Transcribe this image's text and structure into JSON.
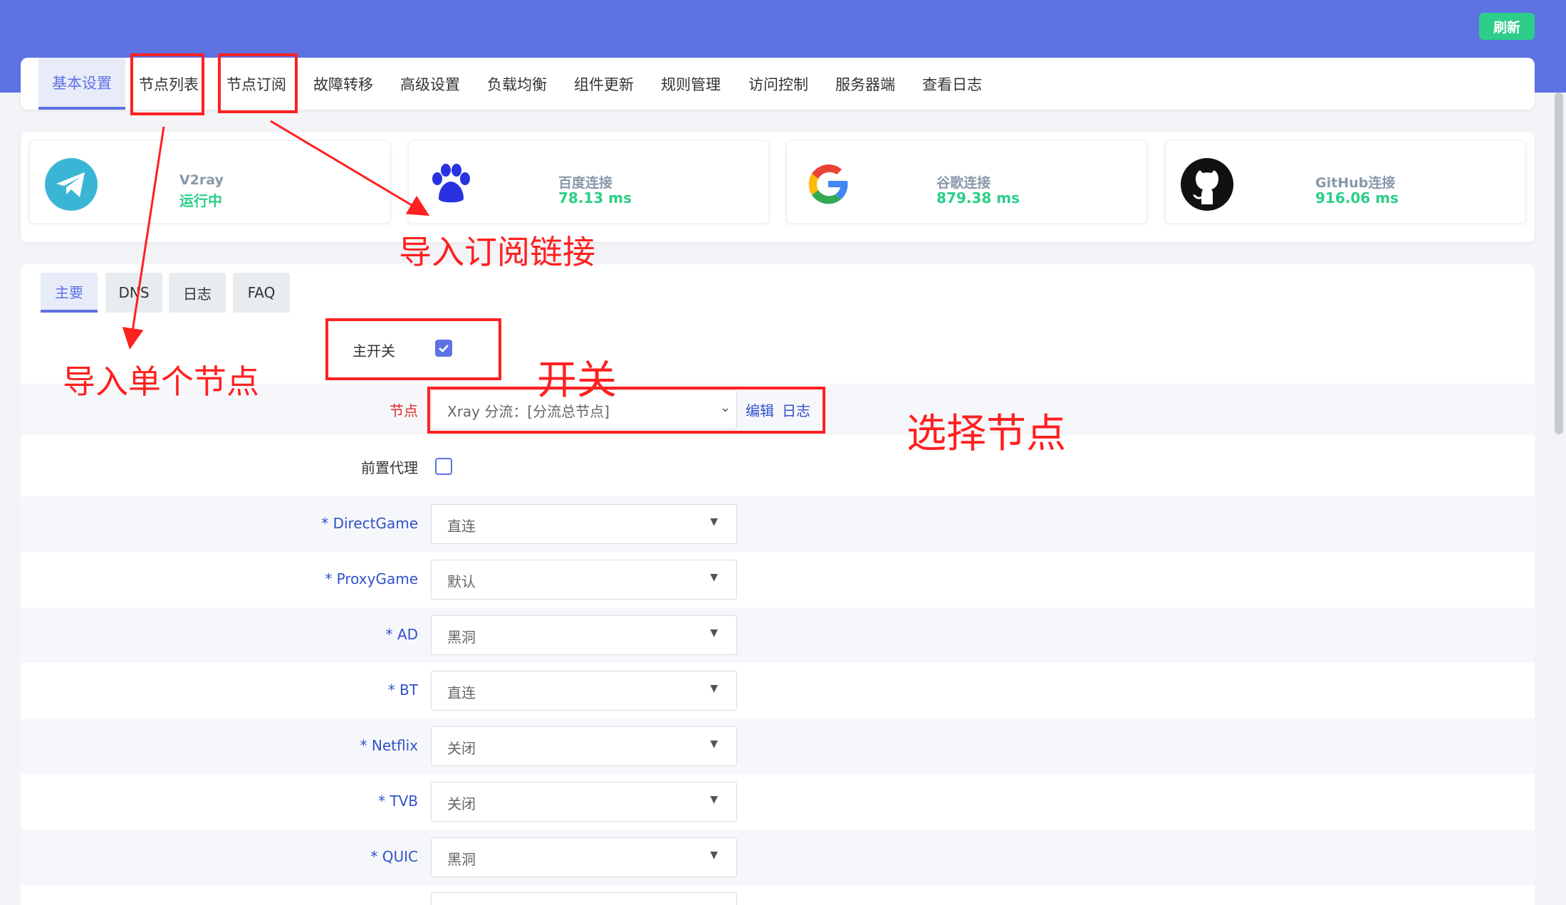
{
  "header": {
    "refresh_label": "刷新"
  },
  "nav": {
    "tabs": [
      {
        "label": "基本设置",
        "active": true
      },
      {
        "label": "节点列表"
      },
      {
        "label": "节点订阅"
      },
      {
        "label": "故障转移"
      },
      {
        "label": "高级设置"
      },
      {
        "label": "负载均衡"
      },
      {
        "label": "组件更新"
      },
      {
        "label": "规则管理"
      },
      {
        "label": "访问控制"
      },
      {
        "label": "服务器端"
      },
      {
        "label": "查看日志"
      }
    ]
  },
  "status": [
    {
      "name": "V2ray",
      "value": "运行中",
      "icon": "telegram-plane-icon"
    },
    {
      "name": "百度连接",
      "value": "78.13 ms",
      "icon": "baidu-paw-icon"
    },
    {
      "name": "谷歌连接",
      "value": "879.38 ms",
      "icon": "google-g-icon"
    },
    {
      "name": "GitHub连接",
      "value": "916.06 ms",
      "icon": "github-icon"
    }
  ],
  "subtabs": [
    {
      "label": "主要",
      "active": true
    },
    {
      "label": "DNS"
    },
    {
      "label": "日志"
    },
    {
      "label": "FAQ"
    }
  ],
  "form": {
    "main_switch": {
      "label": "主开关",
      "checked": true
    },
    "node": {
      "label": "节点",
      "value": "Xray 分流：[分流总节点]",
      "edit": "编辑",
      "log": "日志"
    },
    "pre_proxy": {
      "label": "前置代理",
      "checked": false
    },
    "shunt_rules": [
      {
        "label": "* DirectGame",
        "value": "直连"
      },
      {
        "label": "* ProxyGame",
        "value": "默认"
      },
      {
        "label": "* AD",
        "value": "黑洞"
      },
      {
        "label": "* BT",
        "value": "直连"
      },
      {
        "label": "* Netflix",
        "value": "关闭"
      },
      {
        "label": "* TVB",
        "value": "关闭"
      },
      {
        "label": "* QUIC",
        "value": "黑洞"
      }
    ]
  },
  "annotations": {
    "import_sub": "导入订阅链接",
    "import_single": "导入单个节点",
    "switch": "开关",
    "select_node": "选择节点"
  },
  "colors": {
    "accent": "#5e72e4",
    "success": "#2dce89",
    "annotation": "#ff2020",
    "label_blue": "#3251c9"
  }
}
